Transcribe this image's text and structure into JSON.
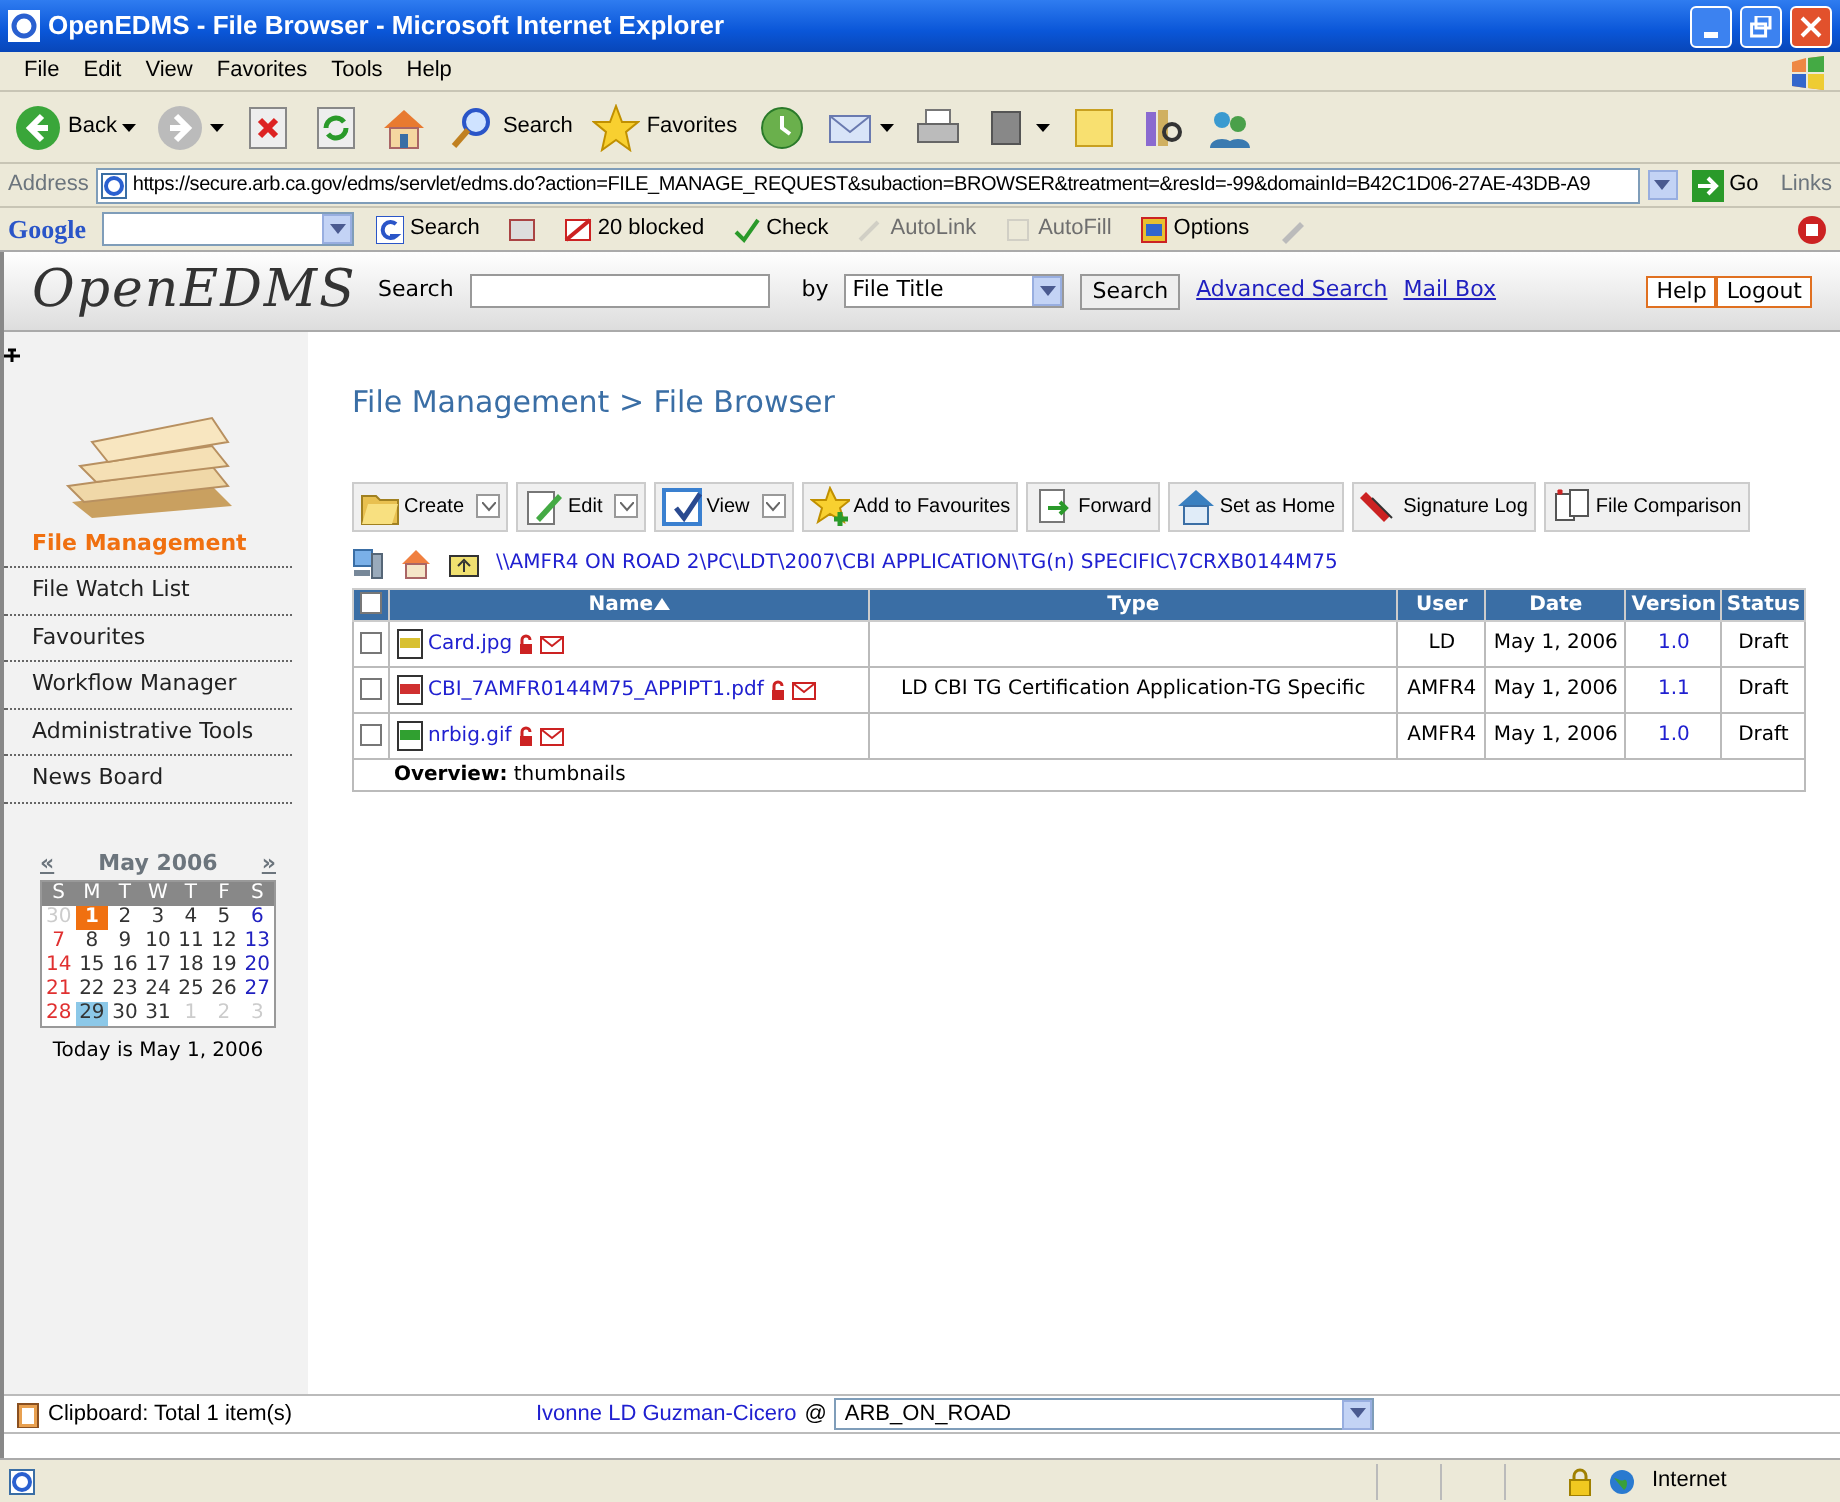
{
  "window": {
    "title": "OpenEDMS - File Browser - Microsoft Internet Explorer"
  },
  "menu": [
    "File",
    "Edit",
    "View",
    "Favorites",
    "Tools",
    "Help"
  ],
  "ie_toolbar": [
    {
      "kind": "back",
      "label": "Back",
      "menu": true
    },
    {
      "kind": "forward",
      "menu": true
    },
    {
      "kind": "stop",
      "menu": false
    },
    {
      "kind": "refresh",
      "menu": false
    },
    {
      "kind": "home",
      "menu": false
    },
    {
      "kind": "search",
      "label": "Search",
      "menu": false
    },
    {
      "kind": "favorites",
      "label": "Favorites",
      "menu": false
    },
    {
      "kind": "history",
      "menu": false
    },
    {
      "kind": "mail",
      "menu": true
    },
    {
      "kind": "print",
      "menu": false
    },
    {
      "kind": "edit",
      "menu": true
    },
    {
      "kind": "note",
      "menu": false
    },
    {
      "kind": "research",
      "menu": false
    },
    {
      "kind": "messenger",
      "menu": false
    }
  ],
  "address": {
    "label": "Address",
    "url": "https://secure.arb.ca.gov/edms/servlet/edms.do?action=FILE_MANAGE_REQUEST&subaction=BROWSER&treatment=&resId=-99&domainId=B42C1D06-27AE-43DB-A9",
    "go": "Go",
    "links": "Links"
  },
  "google_bar": {
    "logo": "Google",
    "items": [
      {
        "kind": "search",
        "label": "Search",
        "disabled": false
      },
      {
        "kind": "news",
        "disabled": false
      },
      {
        "kind": "popup",
        "label": "20 blocked",
        "disabled": false
      },
      {
        "kind": "spell",
        "label": "Check",
        "disabled": false
      },
      {
        "kind": "autolink",
        "label": "AutoLink",
        "disabled": true
      },
      {
        "kind": "autofill",
        "label": "AutoFill",
        "disabled": true
      },
      {
        "kind": "options",
        "label": "Options",
        "disabled": false
      },
      {
        "kind": "pen",
        "disabled": false
      }
    ]
  },
  "app_header": {
    "logo": "OpenEDMS",
    "search_label": "Search",
    "by_label": "by",
    "by_value": "File Title",
    "search_button": "Search",
    "links": [
      "Advanced Search",
      "Mail Box"
    ],
    "buttons": [
      "Help",
      "Logout"
    ]
  },
  "sidebar": {
    "items": [
      {
        "label": "File Management",
        "selected": true
      },
      {
        "label": "File Watch List",
        "selected": false
      },
      {
        "label": "Favourites",
        "selected": false
      },
      {
        "label": "Workflow Manager",
        "selected": false
      },
      {
        "label": "Administrative Tools",
        "selected": false
      },
      {
        "label": "News Board",
        "selected": false
      }
    ],
    "calendar": {
      "prev": "«",
      "month": "May 2006",
      "next": "»",
      "weekdays": [
        "S",
        "M",
        "T",
        "W",
        "T",
        "F",
        "S"
      ],
      "weeks": [
        [
          {
            "label": "30",
            "kind": "other",
            "today": false,
            "selected": false
          },
          {
            "label": "1",
            "kind": "day",
            "today": true,
            "selected": false
          },
          {
            "label": "2",
            "kind": "day",
            "today": false,
            "selected": false
          },
          {
            "label": "3",
            "kind": "day",
            "today": false,
            "selected": false
          },
          {
            "label": "4",
            "kind": "day",
            "today": false,
            "selected": false
          },
          {
            "label": "5",
            "kind": "day",
            "today": false,
            "selected": false
          },
          {
            "label": "6",
            "kind": "day",
            "today": false,
            "selected": false
          }
        ],
        [
          {
            "label": "7",
            "kind": "day",
            "today": false,
            "selected": false
          },
          {
            "label": "8",
            "kind": "day",
            "today": false,
            "selected": false
          },
          {
            "label": "9",
            "kind": "day",
            "today": false,
            "selected": false
          },
          {
            "label": "10",
            "kind": "day",
            "today": false,
            "selected": false
          },
          {
            "label": "11",
            "kind": "day",
            "today": false,
            "selected": false
          },
          {
            "label": "12",
            "kind": "day",
            "today": false,
            "selected": false
          },
          {
            "label": "13",
            "kind": "day",
            "today": false,
            "selected": false
          }
        ],
        [
          {
            "label": "14",
            "kind": "day",
            "today": false,
            "selected": false
          },
          {
            "label": "15",
            "kind": "day",
            "today": false,
            "selected": false
          },
          {
            "label": "16",
            "kind": "day",
            "today": false,
            "selected": false
          },
          {
            "label": "17",
            "kind": "day",
            "today": false,
            "selected": false
          },
          {
            "label": "18",
            "kind": "day",
            "today": false,
            "selected": false
          },
          {
            "label": "19",
            "kind": "day",
            "today": false,
            "selected": false
          },
          {
            "label": "20",
            "kind": "day",
            "today": false,
            "selected": false
          }
        ],
        [
          {
            "label": "21",
            "kind": "day",
            "today": false,
            "selected": false
          },
          {
            "label": "22",
            "kind": "day",
            "today": false,
            "selected": false
          },
          {
            "label": "23",
            "kind": "day",
            "today": false,
            "selected": false
          },
          {
            "label": "24",
            "kind": "day",
            "today": false,
            "selected": false
          },
          {
            "label": "25",
            "kind": "day",
            "today": false,
            "selected": false
          },
          {
            "label": "26",
            "kind": "day",
            "today": false,
            "selected": false
          },
          {
            "label": "27",
            "kind": "day",
            "today": false,
            "selected": false
          }
        ],
        [
          {
            "label": "28",
            "kind": "day",
            "today": false,
            "selected": false
          },
          {
            "label": "29",
            "kind": "day",
            "today": false,
            "selected": true
          },
          {
            "label": "30",
            "kind": "day",
            "today": false,
            "selected": false
          },
          {
            "label": "31",
            "kind": "day",
            "today": false,
            "selected": false
          },
          {
            "label": "1",
            "kind": "other",
            "today": false,
            "selected": false
          },
          {
            "label": "2",
            "kind": "other",
            "today": false,
            "selected": false
          },
          {
            "label": "3",
            "kind": "other",
            "today": false,
            "selected": false
          }
        ]
      ],
      "caption": "Today is May 1, 2006"
    }
  },
  "main": {
    "breadcrumb": "File Management > File Browser",
    "actions": [
      {
        "kind": "create",
        "label": "Create",
        "menu": true
      },
      {
        "kind": "edit",
        "label": "Edit",
        "menu": true
      },
      {
        "kind": "view",
        "label": "View",
        "menu": true
      },
      {
        "kind": "favourite",
        "label": "Add to Favourites",
        "menu": false
      },
      {
        "kind": "forward",
        "label": "Forward",
        "menu": false
      },
      {
        "kind": "home",
        "label": "Set as Home",
        "menu": false
      },
      {
        "kind": "signature",
        "label": "Signature Log",
        "menu": false
      },
      {
        "kind": "compare",
        "label": "File Comparison",
        "menu": false
      }
    ],
    "path": "\\\\AMFR4 ON ROAD 2\\PC\\LDT\\2007\\CBI APPLICATION\\TG(n) SPECIFIC\\7CRXB0144M75",
    "table": {
      "select_all": false,
      "columns": [
        {
          "label": "Name",
          "sorted": true
        },
        {
          "label": "Type",
          "sorted": false
        },
        {
          "label": "User",
          "sorted": false
        },
        {
          "label": "Date",
          "sorted": false
        },
        {
          "label": "Version",
          "sorted": false
        },
        {
          "label": "Status",
          "sorted": false
        }
      ],
      "rows": [
        {
          "checked": false,
          "kind": "jpg",
          "name": "Card.jpg",
          "user": "LD",
          "date": "May 1, 2006",
          "version": "1.0",
          "status": "Draft"
        },
        {
          "checked": false,
          "kind": "pdf",
          "name": "CBI_7AMFR0144M75_APPIPT1.pdf",
          "type": "LD CBI TG Certification Application-TG Specific",
          "user": "AMFR4",
          "date": "May 1, 2006",
          "version": "1.1",
          "status": "Draft"
        },
        {
          "checked": false,
          "kind": "gif",
          "name": "nrbig.gif",
          "user": "AMFR4",
          "date": "May 1, 2006",
          "version": "1.0",
          "status": "Draft"
        }
      ],
      "overview": "**Overview:** thumbnails"
    }
  },
  "footer": {
    "clipboard": "Clipboard: Total 1 item(s)",
    "user": "Ivonne LD Guzman-Cicero",
    "at": "@",
    "domain": "ARB_ON_ROAD"
  },
  "status_bar": {
    "zone": "Internet"
  }
}
